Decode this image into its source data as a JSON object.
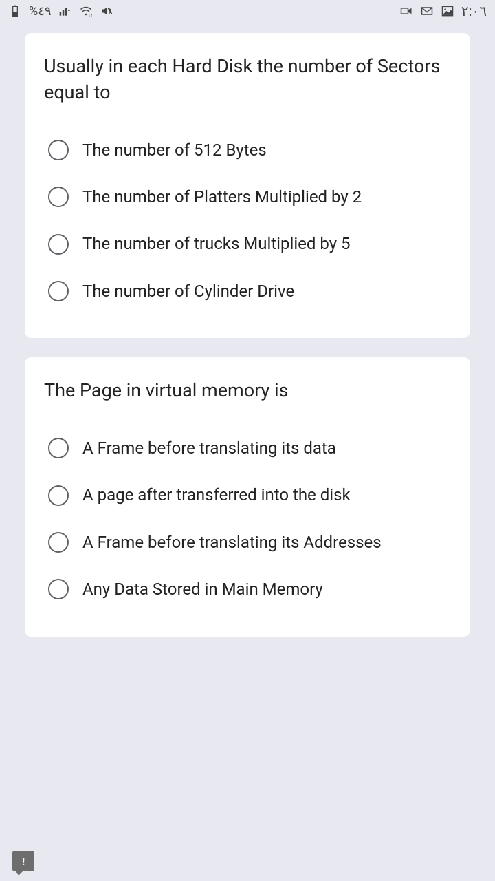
{
  "status": {
    "battery": "٤٩%",
    "time": "٢:٠٦"
  },
  "questions": [
    {
      "prompt": "Usually in each Hard Disk the number of Sectors equal to",
      "options": [
        "The number of 512 Bytes",
        "The number of Platters Multiplied by 2",
        "The number of trucks Multiplied by 5",
        "The number of Cylinder Drive"
      ]
    },
    {
      "prompt": "The Page in virtual memory is",
      "options": [
        "A Frame before translating its data",
        "A page after transferred into the disk",
        "A Frame before translating its Addresses",
        "Any Data Stored in Main Memory"
      ]
    }
  ]
}
